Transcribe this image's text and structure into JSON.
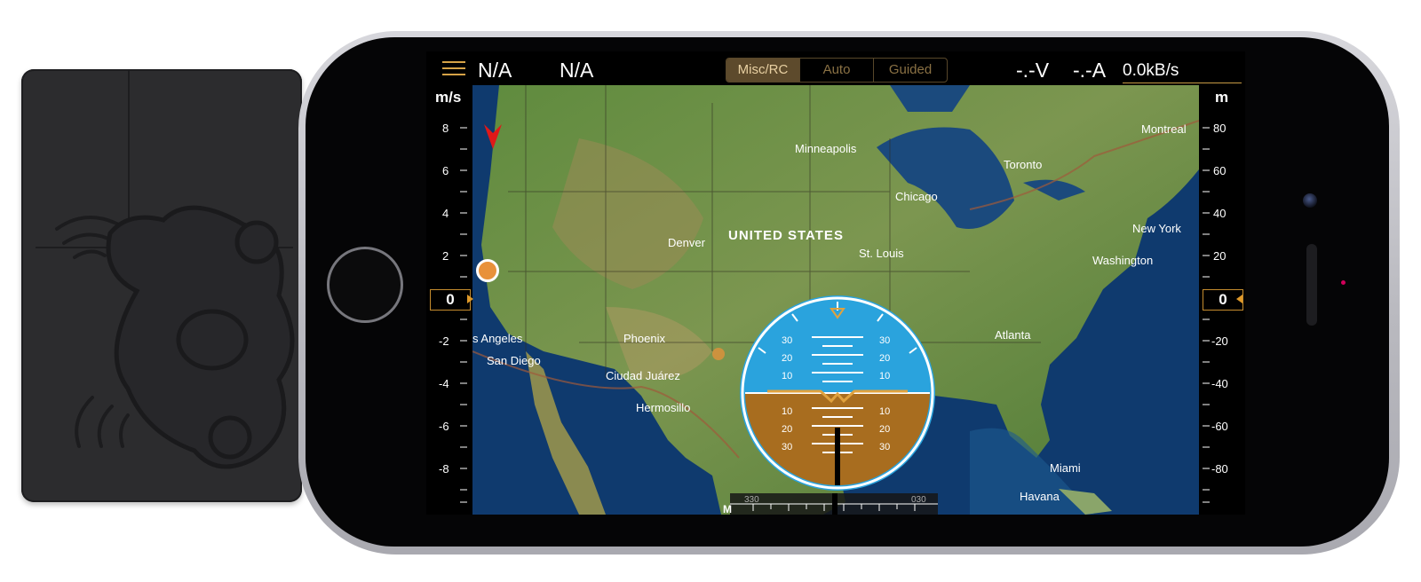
{
  "telemetry": {
    "left_status": "N/A",
    "right_status": "N/A",
    "voltage": "-.-V",
    "current": "-.-A",
    "data_rate": "0.0kB/s"
  },
  "modes": [
    {
      "label": "Misc/RC",
      "active": true
    },
    {
      "label": "Auto",
      "active": false
    },
    {
      "label": "Guided",
      "active": false
    }
  ],
  "speed_tape": {
    "unit": "m/s",
    "ticks": [
      "8",
      "6",
      "4",
      "2",
      "-2",
      "-4",
      "-6",
      "-8"
    ],
    "current": "0"
  },
  "altitude_tape": {
    "unit": "m",
    "ticks": [
      "80",
      "60",
      "40",
      "20",
      "-20",
      "-40",
      "-60",
      "-80"
    ],
    "current": "0"
  },
  "map": {
    "country_label": "UNITED STATES",
    "cities": [
      "Minneapolis",
      "Montreal",
      "Toronto",
      "Chicago",
      "New York",
      "Denver",
      "St. Louis",
      "Washington",
      "Atlanta",
      "s Angeles",
      "Phoenix",
      "San Diego",
      "Ciudad Juárez",
      "Hermosillo",
      "Miami",
      "Havana"
    ]
  },
  "attitude_indicator": {
    "pitch_labels": [
      "30",
      "20",
      "10",
      "10",
      "20",
      "30"
    ]
  },
  "heading_strip": {
    "labels": [
      "330",
      "030"
    ],
    "left_mark": "M"
  },
  "colors": {
    "accent": "#d6a347",
    "sky": "#2aa3dd",
    "ground": "#a86d1f",
    "marker_orange": "#e8913a",
    "vehicle_arrow": "#e01818"
  },
  "icons": {
    "menu": "hamburger-icon",
    "vehicle": "vehicle-arrow-icon",
    "home": "home-marker-icon"
  }
}
